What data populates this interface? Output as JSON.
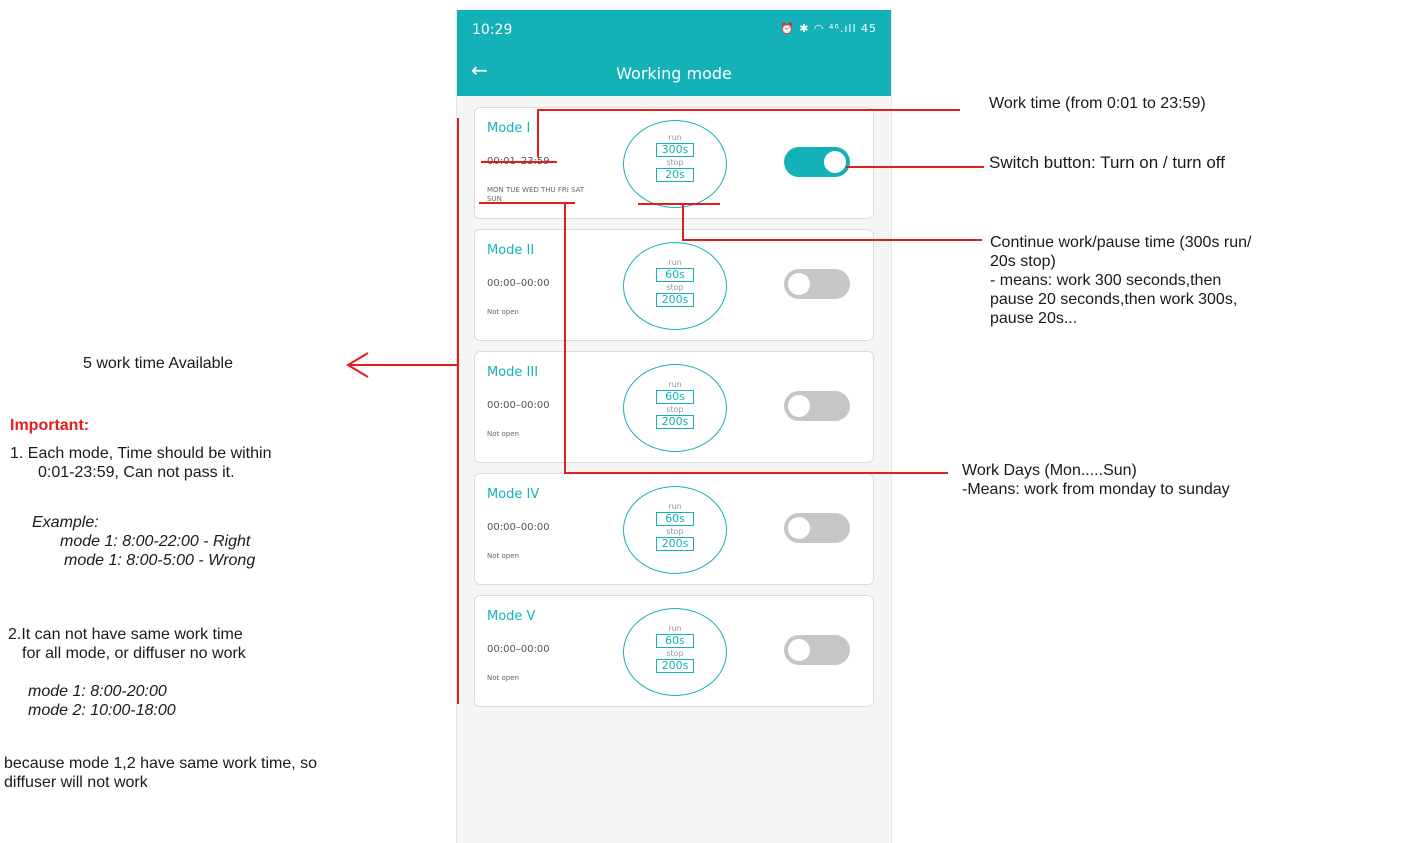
{
  "status_bar": {
    "time": "10:29",
    "icons": "⏰ ✱ ◠ ⁴⁶.ıll 45"
  },
  "app_bar": {
    "back_glyph": "←",
    "title": "Working mode"
  },
  "modes": [
    {
      "name": "Mode I",
      "time": "00:01–23:59",
      "days": "MON TUE WED THU FRI SAT SUN",
      "run_label": "run",
      "run_value": "300s",
      "stop_label": "stop",
      "stop_value": "20s",
      "enabled": true
    },
    {
      "name": "Mode II",
      "time": "00:00–00:00",
      "days": "Not open",
      "run_label": "run",
      "run_value": "60s",
      "stop_label": "stop",
      "stop_value": "200s",
      "enabled": false
    },
    {
      "name": "Mode III",
      "time": "00:00–00:00",
      "days": "Not open",
      "run_label": "run",
      "run_value": "60s",
      "stop_label": "stop",
      "stop_value": "200s",
      "enabled": false
    },
    {
      "name": "Mode IV",
      "time": "00:00–00:00",
      "days": "Not open",
      "run_label": "run",
      "run_value": "60s",
      "stop_label": "stop",
      "stop_value": "200s",
      "enabled": false
    },
    {
      "name": "Mode V",
      "time": "00:00–00:00",
      "days": "Not open",
      "run_label": "run",
      "run_value": "60s",
      "stop_label": "stop",
      "stop_value": "200s",
      "enabled": false
    }
  ],
  "annotations": {
    "work_time": "Work time (from 0:01 to 23:59)",
    "switch": "Switch button: Turn on / turn off",
    "continue_line1": "Continue work/pause time (300s run/",
    "continue_line2": "20s stop)",
    "continue_line3": "- means: work 300 seconds,then",
    "continue_line4": "pause 20 seconds,then work 300s,",
    "continue_line5": "pause 20s...",
    "work_days_line1": "Work Days (Mon.....Sun)",
    "work_days_line2": "-Means: work from monday to sunday",
    "available": "5 work time Available",
    "important": "Important:",
    "note1_line1": "1. Each mode, Time should be within",
    "note1_line2": "0:01-23:59, Can not pass it.",
    "example_label": "Example:",
    "example_right": "mode 1: 8:00-22:00 - Right",
    "example_wrong": "mode 1: 8:00-5:00  - Wrong",
    "note2_line1": "2.It can not have same work time",
    "note2_line2": "for all mode, or diffuser no work",
    "note2_ex1": "mode 1: 8:00-20:00",
    "note2_ex2": "mode 2: 10:00-18:00",
    "because_line1": "because mode 1,2 have same work time,  so",
    "because_line2": "diffuser will not work"
  },
  "colors": {
    "accent": "#14b2b8",
    "annotation_red": "#e21d1d",
    "toggle_off": "#c6c6c6"
  }
}
